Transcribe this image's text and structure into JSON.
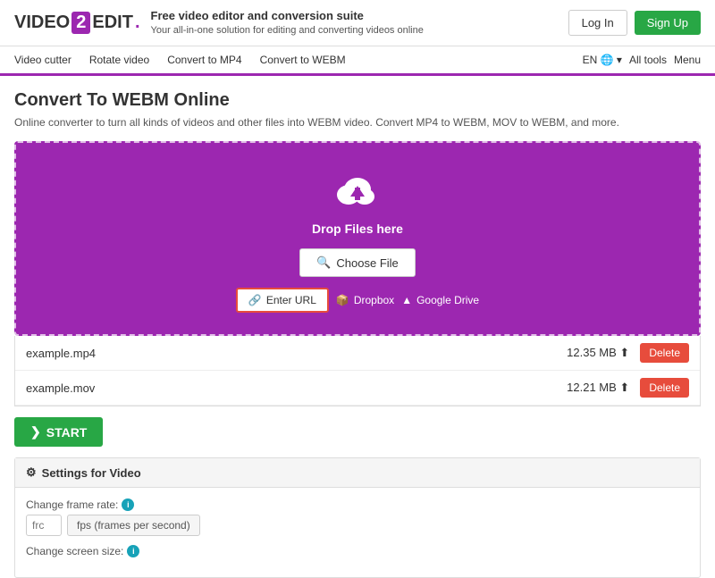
{
  "header": {
    "logo": {
      "video": "VIDEO",
      "two": "2",
      "edit": "EDIT",
      "dot": "."
    },
    "tagline_title": "Free video editor and conversion suite",
    "tagline_sub": "Your all-in-one solution for editing and converting videos online",
    "login_label": "Log In",
    "signup_label": "Sign Up"
  },
  "nav": {
    "items": [
      {
        "label": "Video cutter"
      },
      {
        "label": "Rotate video"
      },
      {
        "label": "Convert to MP4"
      },
      {
        "label": "Convert to WEBM"
      }
    ],
    "lang": "EN",
    "tools": "All tools",
    "menu": "Menu"
  },
  "page": {
    "title": "Convert To WEBM Online",
    "description": "Online converter to turn all kinds of videos and other files into WEBM video. Convert MP4 to WEBM, MOV to WEBM, and more."
  },
  "upload": {
    "drop_text": "Drop Files here",
    "choose_file": "Choose File",
    "enter_url": "Enter URL",
    "dropbox": "Dropbox",
    "google_drive": "Google Drive"
  },
  "files": [
    {
      "name": "example.mp4",
      "size": "12.35 MB"
    },
    {
      "name": "example.mov",
      "size": "12.21 MB"
    }
  ],
  "delete_label": "Delete",
  "start_label": "START",
  "settings": {
    "title": "Settings for Video",
    "frame_rate_label": "Change frame rate:",
    "frame_rate_placeholder": "frc",
    "frame_rate_unit": "fps (frames per second)",
    "screen_size_label": "Change screen size:"
  },
  "icons": {
    "search": "🔍",
    "link": "🔗",
    "dropbox_icon": "📦",
    "gdrive_icon": "▲",
    "gear": "⚙",
    "chevron_right": "❯",
    "upload_cloud": "cloud"
  }
}
